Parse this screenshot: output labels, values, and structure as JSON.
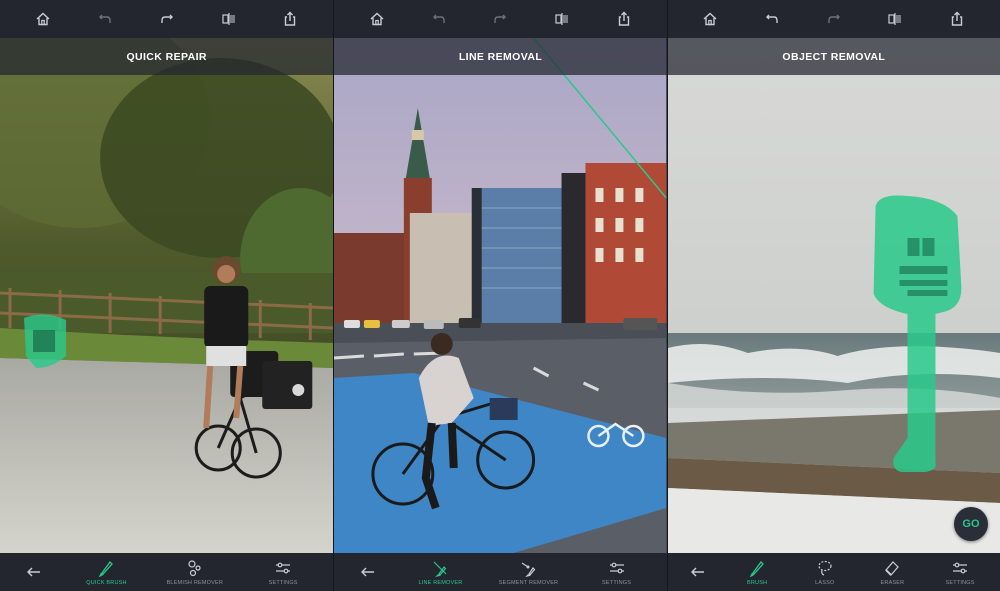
{
  "panels": [
    {
      "title": "QUICK REPAIR",
      "tools": [
        {
          "label": "QUICK BRUSH",
          "icon": "brush-icon",
          "active": true
        },
        {
          "label": "BLEMISH REMOVER",
          "icon": "blemish-icon",
          "active": false
        },
        {
          "label": "SETTINGS",
          "icon": "sliders-icon",
          "active": false
        }
      ]
    },
    {
      "title": "LINE REMOVAL",
      "tools": [
        {
          "label": "LINE REMOVER",
          "icon": "line-remover-icon",
          "active": true
        },
        {
          "label": "SEGMENT REMOVER",
          "icon": "segment-remover-icon",
          "active": false
        },
        {
          "label": "SETTINGS",
          "icon": "sliders-icon",
          "active": false
        }
      ]
    },
    {
      "title": "OBJECT REMOVAL",
      "tools": [
        {
          "label": "BRUSH",
          "icon": "brush-icon",
          "active": true
        },
        {
          "label": "LASSO",
          "icon": "lasso-icon",
          "active": false
        },
        {
          "label": "ERASER",
          "icon": "eraser-icon",
          "active": false
        },
        {
          "label": "SETTINGS",
          "icon": "sliders-icon",
          "active": false
        }
      ],
      "go_label": "GO"
    }
  ],
  "colors": {
    "accent": "#29c98b",
    "toolbar": "#23262f",
    "icon": "#c9ccd3",
    "muted": "#8d919c"
  }
}
